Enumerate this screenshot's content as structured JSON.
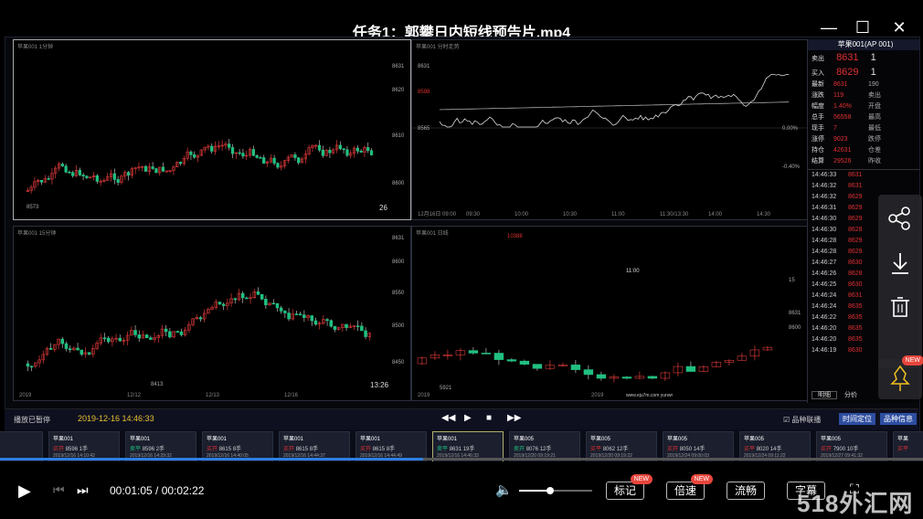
{
  "window": {
    "title": "任务1：郭攀日内短线预告片.mp4",
    "min": "—",
    "max": "☐",
    "close": "✕"
  },
  "panels": {
    "tl": {
      "title": "苹果001 1分钟",
      "prices": [
        "8631",
        "8620",
        "8610",
        "8600"
      ],
      "lo": "8573",
      "count": "26"
    },
    "tr": {
      "title": "苹果001 分时走势",
      "p1": "8631",
      "p2": "8598",
      "p3": "8565",
      "pct1": "0.00%",
      "pct2": "-0.40%",
      "x": [
        "12月16日 09:00",
        "09:30",
        "10:00",
        "10:30",
        "11:00",
        "11:30/13:30",
        "14:00",
        "14:30"
      ]
    },
    "bl": {
      "title": "苹果001 15分钟",
      "prices": [
        "8631",
        "8600",
        "8550",
        "8500",
        "8450"
      ],
      "lo": "8413",
      "count": "13:26",
      "x": [
        "2019",
        "12/12",
        "12/13",
        "12/16"
      ]
    },
    "br": {
      "title": "苹果001 日线",
      "hi": "10388",
      "lo": "5921",
      "mid": "11:00",
      "x": [
        "2019",
        "2019"
      ],
      "wm": "www.eju7m.com yunwr",
      "prices": [
        "8631",
        "8600",
        "15"
      ]
    }
  },
  "quote": {
    "header": "苹果001(AP 001)",
    "ask": {
      "label": "卖出",
      "price": "8631",
      "qty": "1"
    },
    "bid": {
      "label": "买入",
      "price": "8629",
      "qty": "1"
    },
    "stats": [
      [
        "最新",
        "8631",
        "190"
      ],
      [
        "涨跌",
        "119",
        "卖出"
      ],
      [
        "幅度",
        "1.40%",
        "开盘"
      ],
      [
        "总手",
        "56558",
        "最高"
      ],
      [
        "现手",
        "7",
        "最低"
      ],
      [
        "涨停",
        "9023",
        "跌停"
      ],
      [
        "持仓",
        "42631",
        "仓差"
      ],
      [
        "结算",
        "29526",
        "昨收"
      ]
    ],
    "ticks": [
      [
        "14:46:33",
        "8631"
      ],
      [
        "14:46:32",
        "8631"
      ],
      [
        "14:46:32",
        "8629"
      ],
      [
        "14:46:31",
        "8629"
      ],
      [
        "14:46:30",
        "8629"
      ],
      [
        "14:46:30",
        "8628"
      ],
      [
        "14:46:28",
        "8629"
      ],
      [
        "14:46:28",
        "8629"
      ],
      [
        "14:46:27",
        "8630"
      ],
      [
        "14:46:26",
        "8628"
      ],
      [
        "14:46:25",
        "8630"
      ],
      [
        "14:46:24",
        "8631"
      ],
      [
        "14:46:24",
        "8635"
      ],
      [
        "14:46:22",
        "8635"
      ],
      [
        "14:46:20",
        "8635"
      ],
      [
        "14:46:20",
        "8635"
      ],
      [
        "14:46:19",
        "8630"
      ]
    ],
    "tabs": [
      "明细",
      "分价"
    ]
  },
  "player_controls": {
    "left": "播放已暂停",
    "datetime": "2019-12-16 14:46:33",
    "opt": "品种联播",
    "btn1": "时间定位",
    "btn2": "品种信息"
  },
  "trades": [
    {
      "name": "",
      "a": "00",
      "b": "1手",
      "t": "14:15:08"
    },
    {
      "name": "苹果001",
      "a": "买开",
      "b": "8596 1手",
      "t": "2019/12/16 14:10:42"
    },
    {
      "name": "苹果001",
      "a": "卖平",
      "b": "8596 2手",
      "t": "2019/12/16 14:29:32"
    },
    {
      "name": "苹果001",
      "a": "买开",
      "b": "8615 8手",
      "t": "2019/12/16 14:40:05"
    },
    {
      "name": "苹果001",
      "a": "买开",
      "b": "8615 8手",
      "t": "2019/12/16 14:44:37"
    },
    {
      "name": "苹果001",
      "a": "买开",
      "b": "8615 8手",
      "t": "2019/12/16 14:44:49"
    },
    {
      "name": "苹果001",
      "a": "卖平",
      "b": "8631 19手",
      "t": "2019/12/16 14:46:33"
    },
    {
      "name": "苹果005",
      "a": "卖开",
      "b": "8076 12手",
      "t": "2019/12/20 09:19:21"
    },
    {
      "name": "苹果005",
      "a": "买平",
      "b": "8062 12手",
      "t": "2019/12/20 09:19:22"
    },
    {
      "name": "苹果005",
      "a": "买开",
      "b": "8050 14手",
      "t": "2019/12/24 09:00:03"
    },
    {
      "name": "苹果005",
      "a": "买平",
      "b": "8020 14手",
      "t": "2019/12/24 09:11:22"
    },
    {
      "name": "苹果005",
      "a": "买开",
      "b": "7900 10手",
      "t": "2019/12/27 09:41:32"
    },
    {
      "name": "苹果",
      "a": "买平",
      "b": "",
      "t": ""
    }
  ],
  "playback": {
    "time": "00:01:05 / 00:02:22",
    "progress": 0.458,
    "buttons": [
      "标记",
      "倍速",
      "流畅",
      "字幕"
    ],
    "new": "NEW"
  },
  "side": {
    "new": "NEW"
  },
  "watermark": "518外汇网"
}
